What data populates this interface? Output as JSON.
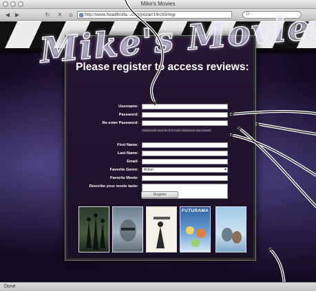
{
  "window": {
    "title": "Mike's Movies"
  },
  "toolbar": {
    "url": "http://www.headfirstla...com/pozar/14/ch5/regi",
    "search_placeholder": "G-"
  },
  "status": {
    "text": "Done"
  },
  "site": {
    "logo_text": "Mike's Movies"
  },
  "form": {
    "heading": "Please register to access reviews:",
    "username_label": "Username:",
    "password_label": "Password:",
    "reenter_password_label": "Re-enter Password:",
    "password_hint": "Passwords must be 6 or more characters and contain",
    "first_name_label": "First Name:",
    "last_name_label": "Last Name:",
    "email_label": "Email:",
    "favorite_genre_label": "Favorite Genre:",
    "favorite_genre_value": "Action",
    "favorite_movie_label": "Favorite Movie:",
    "describe_label": "Describe your movie taste:",
    "submit_label": "Register"
  },
  "posters": [
    {
      "label": ""
    },
    {
      "label": ""
    },
    {
      "label": ""
    },
    {
      "label": "FUTURAMA"
    },
    {
      "label": ""
    }
  ]
}
